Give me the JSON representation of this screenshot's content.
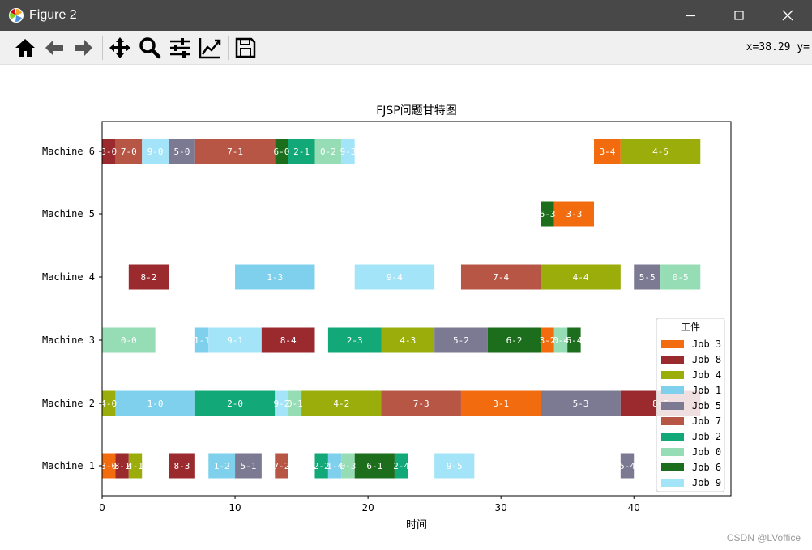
{
  "window": {
    "title": "Figure 2"
  },
  "toolbar": {
    "icons": [
      "home-icon",
      "back-arrow-icon",
      "forward-arrow-icon",
      "pan-icon",
      "zoom-icon",
      "subplots-config-icon",
      "axes-edit-icon",
      "save-icon"
    ],
    "coordinate_readout": "x=38.29 y="
  },
  "watermark": "CSDN @LVoffice",
  "chart_data": {
    "type": "gantt",
    "title": "FJSP问题甘特图",
    "xlabel": "时间",
    "ylabel": "",
    "xlim": [
      0,
      47.3
    ],
    "xticks": [
      0,
      10,
      20,
      30,
      40
    ],
    "machines": [
      "Machine 1",
      "Machine 2",
      "Machine 3",
      "Machine 4",
      "Machine 5",
      "Machine 6"
    ],
    "legend": {
      "title": "工件",
      "placement": "center-right",
      "entries": [
        {
          "name": "Job 3",
          "color": "#f26b0f"
        },
        {
          "name": "Job 8",
          "color": "#9b2a2e"
        },
        {
          "name": "Job 4",
          "color": "#9aad0a"
        },
        {
          "name": "Job 1",
          "color": "#7fd0ec"
        },
        {
          "name": "Job 5",
          "color": "#7c7a92"
        },
        {
          "name": "Job 7",
          "color": "#b75645"
        },
        {
          "name": "Job 2",
          "color": "#12a878"
        },
        {
          "name": "Job 0",
          "color": "#96dcb4"
        },
        {
          "name": "Job 6",
          "color": "#1c6e1c"
        },
        {
          "name": "Job 9",
          "color": "#a4e4f8"
        }
      ]
    },
    "tasks": [
      {
        "machine": "Machine 6",
        "job": "Job 8",
        "label": "8-0",
        "start": 0,
        "end": 1
      },
      {
        "machine": "Machine 6",
        "job": "Job 7",
        "label": "7-0",
        "start": 1,
        "end": 3
      },
      {
        "machine": "Machine 6",
        "job": "Job 9",
        "label": "9-0",
        "start": 3,
        "end": 5
      },
      {
        "machine": "Machine 6",
        "job": "Job 5",
        "label": "5-0",
        "start": 5,
        "end": 7
      },
      {
        "machine": "Machine 6",
        "job": "Job 7",
        "label": "7-1",
        "start": 7,
        "end": 13
      },
      {
        "machine": "Machine 6",
        "job": "Job 6",
        "label": "6-0",
        "start": 13,
        "end": 14
      },
      {
        "machine": "Machine 6",
        "job": "Job 2",
        "label": "2-1",
        "start": 14,
        "end": 16
      },
      {
        "machine": "Machine 6",
        "job": "Job 0",
        "label": "0-2",
        "start": 16,
        "end": 18
      },
      {
        "machine": "Machine 6",
        "job": "Job 9",
        "label": "9-3",
        "start": 18,
        "end": 19
      },
      {
        "machine": "Machine 6",
        "job": "Job 3",
        "label": "3-4",
        "start": 37,
        "end": 39
      },
      {
        "machine": "Machine 6",
        "job": "Job 4",
        "label": "4-5",
        "start": 39,
        "end": 45
      },
      {
        "machine": "Machine 5",
        "job": "Job 6",
        "label": "6-3",
        "start": 33,
        "end": 34
      },
      {
        "machine": "Machine 5",
        "job": "Job 3",
        "label": "3-3",
        "start": 34,
        "end": 37
      },
      {
        "machine": "Machine 4",
        "job": "Job 8",
        "label": "8-2",
        "start": 2,
        "end": 5
      },
      {
        "machine": "Machine 4",
        "job": "Job 1",
        "label": "1-3",
        "start": 10,
        "end": 16
      },
      {
        "machine": "Machine 4",
        "job": "Job 9",
        "label": "9-4",
        "start": 19,
        "end": 25
      },
      {
        "machine": "Machine 4",
        "job": "Job 7",
        "label": "7-4",
        "start": 27,
        "end": 33
      },
      {
        "machine": "Machine 4",
        "job": "Job 4",
        "label": "4-4",
        "start": 33,
        "end": 39
      },
      {
        "machine": "Machine 4",
        "job": "Job 5",
        "label": "5-5",
        "start": 40,
        "end": 42
      },
      {
        "machine": "Machine 4",
        "job": "Job 0",
        "label": "0-5",
        "start": 42,
        "end": 45
      },
      {
        "machine": "Machine 3",
        "job": "Job 0",
        "label": "0-0",
        "start": 0,
        "end": 4
      },
      {
        "machine": "Machine 3",
        "job": "Job 1",
        "label": "1-1",
        "start": 7,
        "end": 8
      },
      {
        "machine": "Machine 3",
        "job": "Job 9",
        "label": "9-1",
        "start": 8,
        "end": 12
      },
      {
        "machine": "Machine 3",
        "job": "Job 8",
        "label": "8-4",
        "start": 12,
        "end": 16
      },
      {
        "machine": "Machine 3",
        "job": "Job 2",
        "label": "2-3",
        "start": 17,
        "end": 21
      },
      {
        "machine": "Machine 3",
        "job": "Job 4",
        "label": "4-3",
        "start": 21,
        "end": 25
      },
      {
        "machine": "Machine 3",
        "job": "Job 5",
        "label": "5-2",
        "start": 25,
        "end": 29
      },
      {
        "machine": "Machine 3",
        "job": "Job 6",
        "label": "6-2",
        "start": 29,
        "end": 33
      },
      {
        "machine": "Machine 3",
        "job": "Job 3",
        "label": "3-2",
        "start": 33,
        "end": 34
      },
      {
        "machine": "Machine 3",
        "job": "Job 0",
        "label": "0-4",
        "start": 34,
        "end": 35
      },
      {
        "machine": "Machine 3",
        "job": "Job 6",
        "label": "6-4",
        "start": 35,
        "end": 36
      },
      {
        "machine": "Machine 2",
        "job": "Job 4",
        "label": "4-0",
        "start": 0,
        "end": 1
      },
      {
        "machine": "Machine 2",
        "job": "Job 1",
        "label": "1-0",
        "start": 1,
        "end": 7
      },
      {
        "machine": "Machine 2",
        "job": "Job 2",
        "label": "2-0",
        "start": 7,
        "end": 13
      },
      {
        "machine": "Machine 2",
        "job": "Job 9",
        "label": "9-2",
        "start": 13,
        "end": 14
      },
      {
        "machine": "Machine 2",
        "job": "Job 0",
        "label": "0-1",
        "start": 14,
        "end": 15
      },
      {
        "machine": "Machine 2",
        "job": "Job 4",
        "label": "4-2",
        "start": 15,
        "end": 21
      },
      {
        "machine": "Machine 2",
        "job": "Job 7",
        "label": "7-3",
        "start": 21,
        "end": 27
      },
      {
        "machine": "Machine 2",
        "job": "Job 3",
        "label": "3-1",
        "start": 27,
        "end": 33
      },
      {
        "machine": "Machine 2",
        "job": "Job 5",
        "label": "5-3",
        "start": 33,
        "end": 39
      },
      {
        "machine": "Machine 2",
        "job": "Job 8",
        "label": "8-5",
        "start": 39,
        "end": 45
      },
      {
        "machine": "Machine 1",
        "job": "Job 3",
        "label": "3-0",
        "start": 0,
        "end": 1
      },
      {
        "machine": "Machine 1",
        "job": "Job 8",
        "label": "8-1",
        "start": 1,
        "end": 2
      },
      {
        "machine": "Machine 1",
        "job": "Job 4",
        "label": "4-1",
        "start": 2,
        "end": 3
      },
      {
        "machine": "Machine 1",
        "job": "Job 8",
        "label": "8-3",
        "start": 5,
        "end": 7
      },
      {
        "machine": "Machine 1",
        "job": "Job 1",
        "label": "1-2",
        "start": 8,
        "end": 10
      },
      {
        "machine": "Machine 1",
        "job": "Job 5",
        "label": "5-1",
        "start": 10,
        "end": 12
      },
      {
        "machine": "Machine 1",
        "job": "Job 7",
        "label": "7-2",
        "start": 13,
        "end": 14
      },
      {
        "machine": "Machine 1",
        "job": "Job 2",
        "label": "2-2",
        "start": 16,
        "end": 17
      },
      {
        "machine": "Machine 1",
        "job": "Job 1",
        "label": "1-4",
        "start": 17,
        "end": 18
      },
      {
        "machine": "Machine 1",
        "job": "Job 0",
        "label": "0-3",
        "start": 18,
        "end": 19
      },
      {
        "machine": "Machine 1",
        "job": "Job 6",
        "label": "6-1",
        "start": 19,
        "end": 22
      },
      {
        "machine": "Machine 1",
        "job": "Job 2",
        "label": "2-4",
        "start": 22,
        "end": 23
      },
      {
        "machine": "Machine 1",
        "job": "Job 9",
        "label": "9-5",
        "start": 25,
        "end": 28
      },
      {
        "machine": "Machine 1",
        "job": "Job 5",
        "label": "5-4",
        "start": 39,
        "end": 40
      }
    ]
  }
}
